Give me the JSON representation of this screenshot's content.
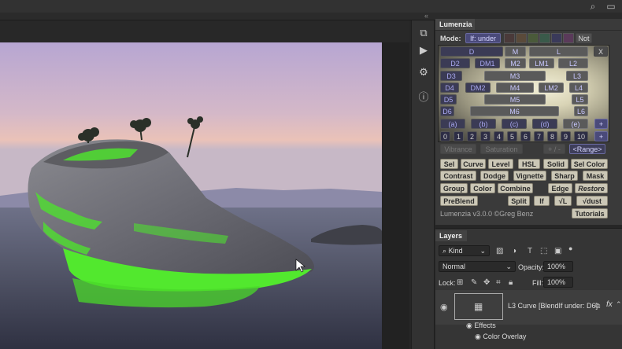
{
  "icons": {
    "search": "search-icon",
    "window": "window-icon",
    "collapse": "collapse-arrows-icon"
  },
  "lumenzia": {
    "tab": "Lumenzia",
    "mode_label": "Mode:",
    "if_under": "If: under",
    "not": "Not",
    "x": "X",
    "zones": [
      {
        "label": "D"
      },
      {
        "label": "M"
      },
      {
        "label": "L"
      },
      {
        "label": "D2"
      },
      {
        "label": "DM1"
      },
      {
        "label": "M2"
      },
      {
        "label": "LM1"
      },
      {
        "label": "L2"
      },
      {
        "label": "D3"
      },
      {
        "label": "M3"
      },
      {
        "label": "L3"
      },
      {
        "label": "D4"
      },
      {
        "label": "DM2"
      },
      {
        "label": "M4"
      },
      {
        "label": "LM2"
      },
      {
        "label": "L4"
      },
      {
        "label": "D5"
      },
      {
        "label": "M5"
      },
      {
        "label": "L5"
      },
      {
        "label": "D6"
      },
      {
        "label": "M6"
      },
      {
        "label": "L6"
      }
    ],
    "letters": [
      "(a)",
      "(b)",
      "(c)",
      "(d)",
      "(e)"
    ],
    "plus": "+",
    "numbers": [
      "0",
      "1",
      "2",
      "3",
      "4",
      "5",
      "6",
      "7",
      "8",
      "9",
      "10"
    ],
    "vibrance": "Vibrance",
    "saturation": "Saturation",
    "plusminus": "+ / -",
    "range": "<Range>",
    "actions_row1": [
      "Sel",
      "Curve",
      "Level",
      "HSL",
      "Solid",
      "Sel Color"
    ],
    "actions_row2": [
      "Contrast",
      "Dodge",
      "Vignette",
      "Sharp",
      "Mask"
    ],
    "actions_row3": [
      "Group",
      "Color",
      "Combine",
      "Edge",
      "Restore"
    ],
    "actions_row4": [
      "PreBlend",
      "Split",
      "If",
      "√L",
      "√dust"
    ],
    "version": "Lumenzia v3.0.0 ©Greg Benz",
    "tutorials": "Tutorials"
  },
  "layers": {
    "tab": "Layers",
    "kind": "Kind",
    "blend_mode": "Normal",
    "opacity_label": "Opacity:",
    "opacity_value": "100%",
    "lock_label": "Lock:",
    "fill_label": "Fill:",
    "fill_value": "100%",
    "layer_name": "L3 Curve [BlendIf under: D6]",
    "fx": "fx",
    "effects": "Effects",
    "color_overlay": "Color Overlay"
  },
  "colors": {
    "mask_green": "#4fe030",
    "panel_bg": "#3a3a3a",
    "zone_text": "#a9a8f0"
  }
}
